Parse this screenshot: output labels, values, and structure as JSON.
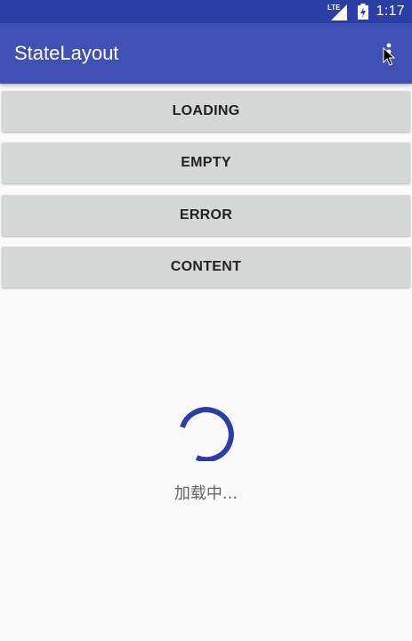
{
  "status_bar": {
    "network_label": "LTE",
    "time": "1:17"
  },
  "app_bar": {
    "title": "StateLayout",
    "overflow_icon": "more-vert-icon"
  },
  "buttons": [
    {
      "label": "LOADING"
    },
    {
      "label": "EMPTY"
    },
    {
      "label": "ERROR"
    },
    {
      "label": "CONTENT"
    }
  ],
  "state_view": {
    "loading_text": "加载中..."
  },
  "colors": {
    "primary": "#3f51b5",
    "primary_dark": "#2b3ea6",
    "button_bg": "#d6d7d7",
    "spinner": "#2b3ea6",
    "background": "#fafafa"
  }
}
